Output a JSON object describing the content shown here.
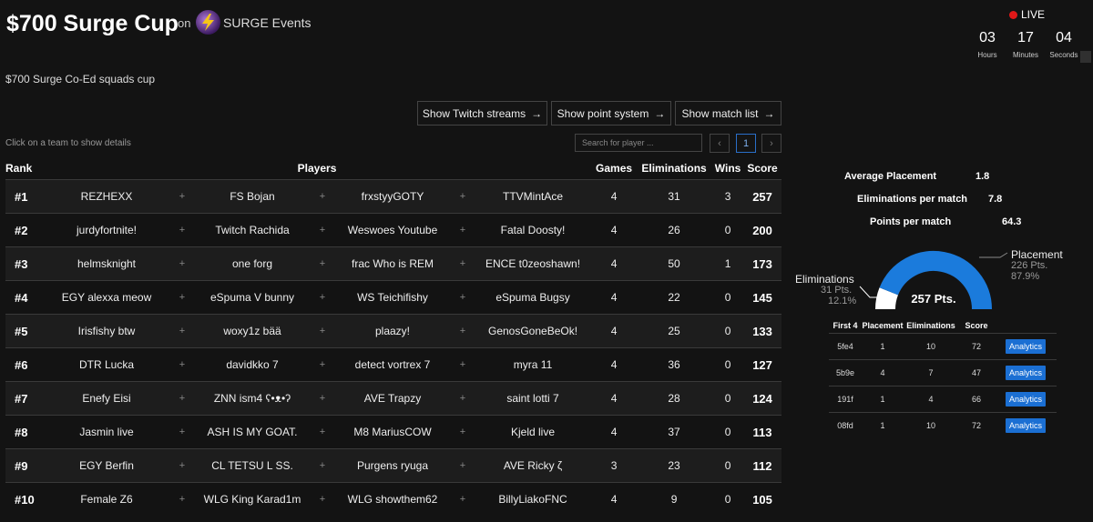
{
  "header": {
    "title": "$700 Surge Cup",
    "on_label": "on",
    "organizer": "SURGE Events",
    "subtitle": "$700 Surge Co-Ed squads cup"
  },
  "status": {
    "live_label": "LIVE"
  },
  "countdown": [
    {
      "value": "03",
      "label": "Hours"
    },
    {
      "value": "17",
      "label": "Minutes"
    },
    {
      "value": "04",
      "label": "Seconds"
    }
  ],
  "buttons": {
    "twitch": "Show Twitch streams",
    "points": "Show point system",
    "matches": "Show match list",
    "arrow": "→"
  },
  "hint": "Click on a team to show details",
  "search": {
    "placeholder": "Search for player ..."
  },
  "pagination": {
    "prev": "‹",
    "current": "1",
    "next": "›"
  },
  "table": {
    "headers": {
      "rank": "Rank",
      "players": "Players",
      "games": "Games",
      "eliminations": "Eliminations",
      "wins": "Wins",
      "score": "Score"
    },
    "plus": "+",
    "rows": [
      {
        "rank": "#1",
        "players": [
          "REZHEXX",
          "FS Bojan",
          "frxstyyGOTY",
          "TTVMintAce"
        ],
        "games": "4",
        "elims": "31",
        "wins": "3",
        "score": "257"
      },
      {
        "rank": "#2",
        "players": [
          "jurdyfortnite!",
          "Twitch Rachida",
          "Weswoes Youtube",
          "Fatal Doosty!"
        ],
        "games": "4",
        "elims": "26",
        "wins": "0",
        "score": "200"
      },
      {
        "rank": "#3",
        "players": [
          "helmsknight",
          "one forg",
          "frac Who is REM",
          "ENCE t0zeoshawn!"
        ],
        "games": "4",
        "elims": "50",
        "wins": "1",
        "score": "173"
      },
      {
        "rank": "#4",
        "players": [
          "EGY alexxa meow",
          "eSpuma V bunny",
          "WS Teichifishy",
          "eSpuma Bugsy"
        ],
        "games": "4",
        "elims": "22",
        "wins": "0",
        "score": "145"
      },
      {
        "rank": "#5",
        "players": [
          "Irisfishy btw",
          "woxy1z bää",
          "plaazy!",
          "GenosGoneBeOk!"
        ],
        "games": "4",
        "elims": "25",
        "wins": "0",
        "score": "133"
      },
      {
        "rank": "#6",
        "players": [
          "DTR Lucka",
          "davidkko 7",
          "detect vortrex 7",
          "myra 11"
        ],
        "games": "4",
        "elims": "36",
        "wins": "0",
        "score": "127"
      },
      {
        "rank": "#7",
        "players": [
          "Enefy Eisi",
          "ZNN ism4 ʕ•ᴥ•ʔ",
          "AVE Trapzy",
          "saint lotti 7"
        ],
        "games": "4",
        "elims": "28",
        "wins": "0",
        "score": "124"
      },
      {
        "rank": "#8",
        "players": [
          "Jasmin live",
          "ASH IS MY GOAT.",
          "M8 MariusCOW",
          "Kjeld live"
        ],
        "games": "4",
        "elims": "37",
        "wins": "0",
        "score": "113"
      },
      {
        "rank": "#9",
        "players": [
          "EGY Berfin",
          "CL TETSU L SS.",
          "Purgens ryuga",
          "AVE Ricky ζ"
        ],
        "games": "3",
        "elims": "23",
        "wins": "0",
        "score": "112"
      },
      {
        "rank": "#10",
        "players": [
          "Female Z6",
          "WLG King Karad1m",
          "WLG showthem62",
          "BillyLiakoFNC"
        ],
        "games": "4",
        "elims": "9",
        "wins": "0",
        "score": "105"
      }
    ]
  },
  "details": {
    "stats": [
      {
        "label": "Average Placement",
        "value": "1.8"
      },
      {
        "label": "Eliminations per match",
        "value": "7.8"
      },
      {
        "label": "Points per match",
        "value": "64.3"
      }
    ],
    "donut": {
      "center": "257 Pts.",
      "placement": {
        "label": "Placement",
        "pts": "226 Pts.",
        "pct": "87.9%",
        "fraction": 0.879,
        "color": "#1b7bdc"
      },
      "eliminations": {
        "label": "Eliminations",
        "pts": "31 Pts.",
        "pct": "12.1%",
        "fraction": 0.121,
        "color": "#ffffff"
      }
    },
    "matches": {
      "headers": [
        "First 4",
        "Placement",
        "Eliminations",
        "Score"
      ],
      "button": "Analytics",
      "rows": [
        {
          "id": "5fe4",
          "placement": "1",
          "elims": "10",
          "score": "72"
        },
        {
          "id": "5b9e",
          "placement": "4",
          "elims": "7",
          "score": "47"
        },
        {
          "id": "191f",
          "placement": "1",
          "elims": "4",
          "score": "66"
        },
        {
          "id": "08fd",
          "placement": "1",
          "elims": "10",
          "score": "72"
        }
      ]
    }
  }
}
